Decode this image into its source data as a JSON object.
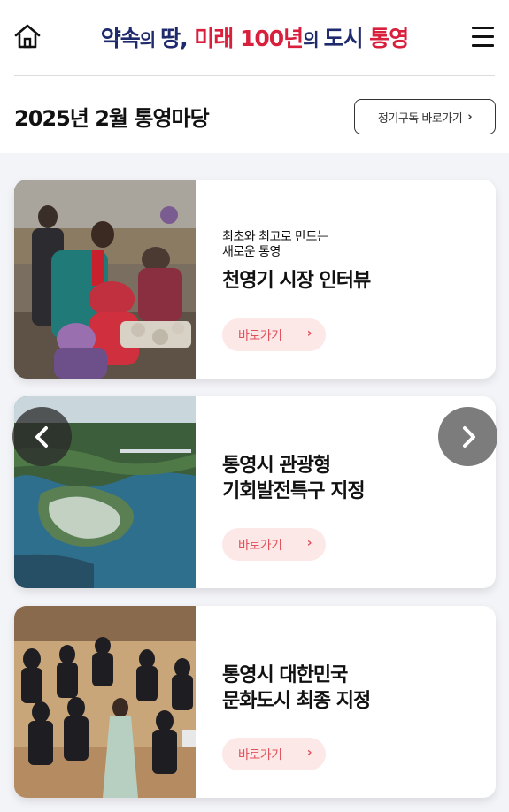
{
  "header": {
    "title_parts": [
      {
        "text": "약속",
        "color": "#1e2a6b"
      },
      {
        "text": "의 ",
        "color": "#1e2a6b"
      },
      {
        "text": "땅, ",
        "color": "#1e2a6b"
      },
      {
        "text": "미래 100년",
        "color": "#d81f3c"
      },
      {
        "text": "의 ",
        "color": "#1e2a6b"
      },
      {
        "text": "도시 ",
        "color": "#1e2a6b"
      },
      {
        "text": "통영",
        "color": "#d81f3c"
      }
    ],
    "home_icon": "home-icon",
    "menu_icon": "hamburger-menu-icon"
  },
  "section": {
    "title": "2025년 2월 통영마당",
    "subscribe_label": "정기구독 바로가기",
    "subscribe_chevron": "›"
  },
  "cards": [
    {
      "subtitle": "최초와 최고로 만드는\n새로운 통영",
      "title": "천영기 시장 인터뷰",
      "button_label": "바로가기",
      "image_desc": "market-photo"
    },
    {
      "subtitle": "",
      "title": "통영시 관광형\n기회발전특구 지정",
      "button_label": "바로가기",
      "image_desc": "island-aerial-photo"
    },
    {
      "subtitle": "",
      "title": "통영시 대한민국\n문화도시 최종 지정",
      "button_label": "바로가기",
      "image_desc": "orchestra-photo"
    }
  ],
  "carousel": {
    "prev_icon": "chevron-left-icon",
    "next_icon": "chevron-right-icon"
  },
  "colors": {
    "navy": "#1e2a6b",
    "red": "#d81f3c",
    "button_bg": "#fde8e8",
    "button_text": "#e0505a",
    "content_bg": "#f3f4f8"
  }
}
